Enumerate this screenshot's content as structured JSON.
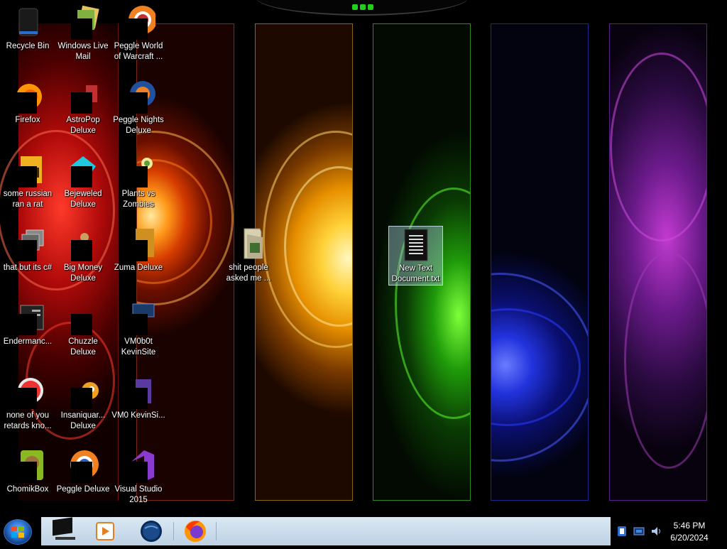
{
  "desktop": {
    "icons": [
      {
        "label": "Recycle Bin"
      },
      {
        "label": "Windows Live Mail"
      },
      {
        "label": "Peggle World of Warcraft ..."
      },
      {
        "label": "Firefox"
      },
      {
        "label": "AstroPop Deluxe"
      },
      {
        "label": "Peggle Nights Deluxe"
      },
      {
        "label": "some russian ran a rat"
      },
      {
        "label": "Bejeweled Deluxe"
      },
      {
        "label": "Plants vs Zombies"
      },
      {
        "label": "that but its c#"
      },
      {
        "label": "Big Money Deluxe"
      },
      {
        "label": "Zuma Deluxe"
      },
      {
        "label": "Endermanc..."
      },
      {
        "label": "Chuzzle Deluxe"
      },
      {
        "label": "VM0b0t KevinSite"
      },
      {
        "label": "none of you retards kno..."
      },
      {
        "label": "Insaniquar... Deluxe"
      },
      {
        "label": "VM0 KevinSi..."
      },
      {
        "label": "ChomikBox"
      },
      {
        "label": "Peggle Deluxe"
      },
      {
        "label": "Visual Studio 2015"
      },
      {
        "label": "shit people asked me ..."
      },
      {
        "label": "New Text Document.txt"
      }
    ]
  },
  "taskbar": {
    "pinned": [
      "media-player-icon",
      "window-switcher-icon",
      "globe-app-icon",
      "firefox-icon"
    ]
  },
  "tray": {
    "time": "5:46 PM",
    "date": "6/20/2024"
  },
  "colors": {
    "taskbar_bg": "#cfdeec",
    "accent_green": "#1fd01a"
  }
}
